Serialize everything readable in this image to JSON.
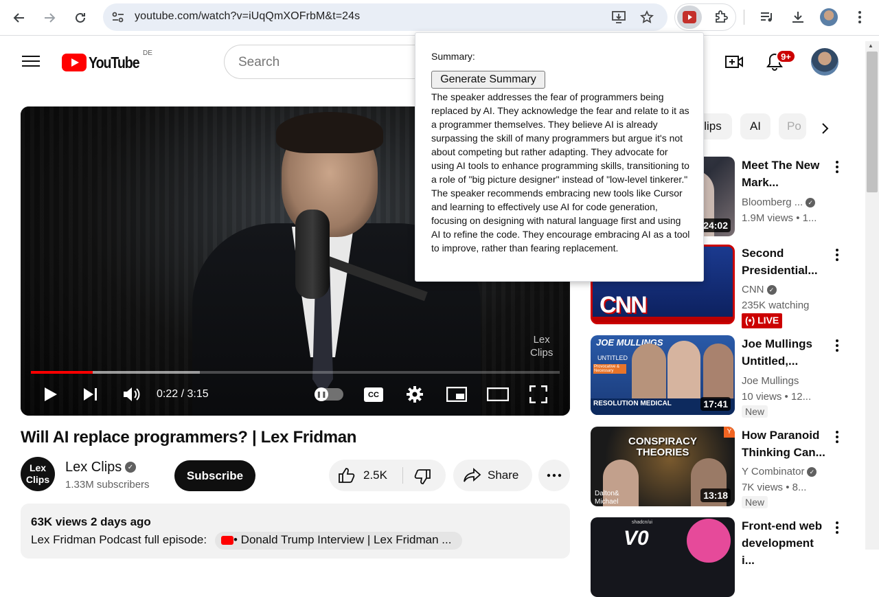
{
  "browser": {
    "url": "youtube.com/watch?v=iUqQmXOFrbM&t=24s"
  },
  "youtube": {
    "logo_text": "YouTube",
    "country": "DE",
    "search_placeholder": "Search",
    "notifications_badge": "9+"
  },
  "player": {
    "watermark_line1": "Lex",
    "watermark_line2": "Clips",
    "time": "0:22 / 3:15",
    "cc_label": "CC",
    "progress_played": 0.117,
    "progress_buffered": 0.32
  },
  "video": {
    "title": "Will AI replace programmers? | Lex Fridman",
    "channel_avatar_line1": "Lex",
    "channel_avatar_line2": "Clips",
    "channel_name": "Lex Clips",
    "subscribers": "1.33M subscribers",
    "subscribe_label": "Subscribe",
    "likes": "2.5K",
    "share_label": "Share",
    "views_date": "63K views  2 days ago",
    "description_prefix": "Lex Fridman Podcast full episode:",
    "description_link": "• Donald Trump Interview | Lex Fridman ..."
  },
  "chips": [
    "lips",
    "AI",
    "Po"
  ],
  "recommendations": [
    {
      "title": "Meet The New Mark...",
      "channel": "Bloomberg ...",
      "meta": "1.9M views • 1...",
      "duration": "24:02",
      "badge": ""
    },
    {
      "title": "Second Presidential...",
      "channel": "CNN",
      "meta": "235K watching",
      "duration": "",
      "badge": "LIVE"
    },
    {
      "title": "Joe Mullings Untitled,...",
      "channel": "Joe Mullings",
      "meta": "10 views  • 12...",
      "duration": "17:41",
      "badge": "New"
    },
    {
      "title": "How Paranoid Thinking Can...",
      "channel": "Y Combinator",
      "meta": "7K views  • 8...",
      "duration": "13:18",
      "badge": "New"
    },
    {
      "title": "Front-end web development i...",
      "channel": "",
      "meta": "",
      "duration": "",
      "badge": ""
    }
  ],
  "thumb_text": {
    "cnn": "CNN",
    "joe_title": "JOE MULLINGS",
    "joe_sub": "UNTITLED",
    "joe_tag": "Provocative & Necessary",
    "joe_banner": "RESOLUTION MEDICAL",
    "yc_title": "CONSPIRACY THEORIES",
    "yc_names": "Dalton& Michael",
    "fe_text": "shadcn/ui"
  },
  "popup": {
    "label": "Summary:",
    "button": "Generate Summary",
    "summary": "The speaker addresses the fear of programmers being replaced by AI. They acknowledge the fear and relate to it as a programmer themselves. They believe AI is already surpassing the skill of many programmers but argue it's not about competing but rather adapting. They advocate for using AI tools to enhance programming skills, transitioning to a role of \"big picture designer\" instead of \"low-level tinkerer.\" The speaker recommends embracing new tools like Cursor and learning to effectively use AI for code generation, focusing on designing with natural language first and using AI to refine the code. They encourage embracing AI as a tool to improve, rather than fearing replacement."
  },
  "colors": {
    "yt_red": "#ff0000",
    "chrome_omnibox": "#e9eef6"
  }
}
